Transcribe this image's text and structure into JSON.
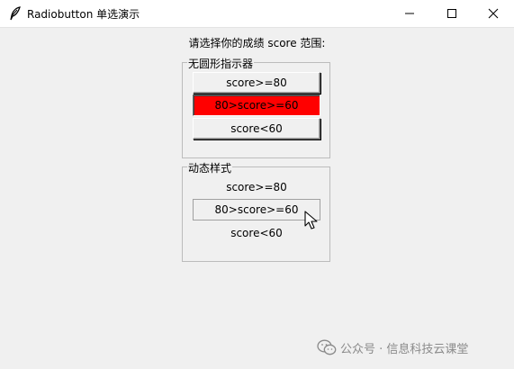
{
  "window": {
    "title": "Radiobutton 单选演示",
    "minimize_glyph": "—",
    "close_glyph": "✕"
  },
  "prompt": "请选择你的成绩 score 范围:",
  "group_no_indicator": {
    "legend": "无圆形指示器",
    "options": [
      {
        "label": "score>=80",
        "selected": false
      },
      {
        "label": "80>score>=60",
        "selected": true
      },
      {
        "label": "score<60",
        "selected": false
      }
    ],
    "selected_color": "#ff0000"
  },
  "group_dynamic": {
    "legend": "动态样式",
    "options": [
      {
        "label": "score>=80",
        "state": "normal"
      },
      {
        "label": "80>score>=60",
        "state": "hover"
      },
      {
        "label": "score<60",
        "state": "normal"
      }
    ]
  },
  "watermark": {
    "text": "公众号 · 信息科技云课堂",
    "icon": "wechat-icon"
  }
}
